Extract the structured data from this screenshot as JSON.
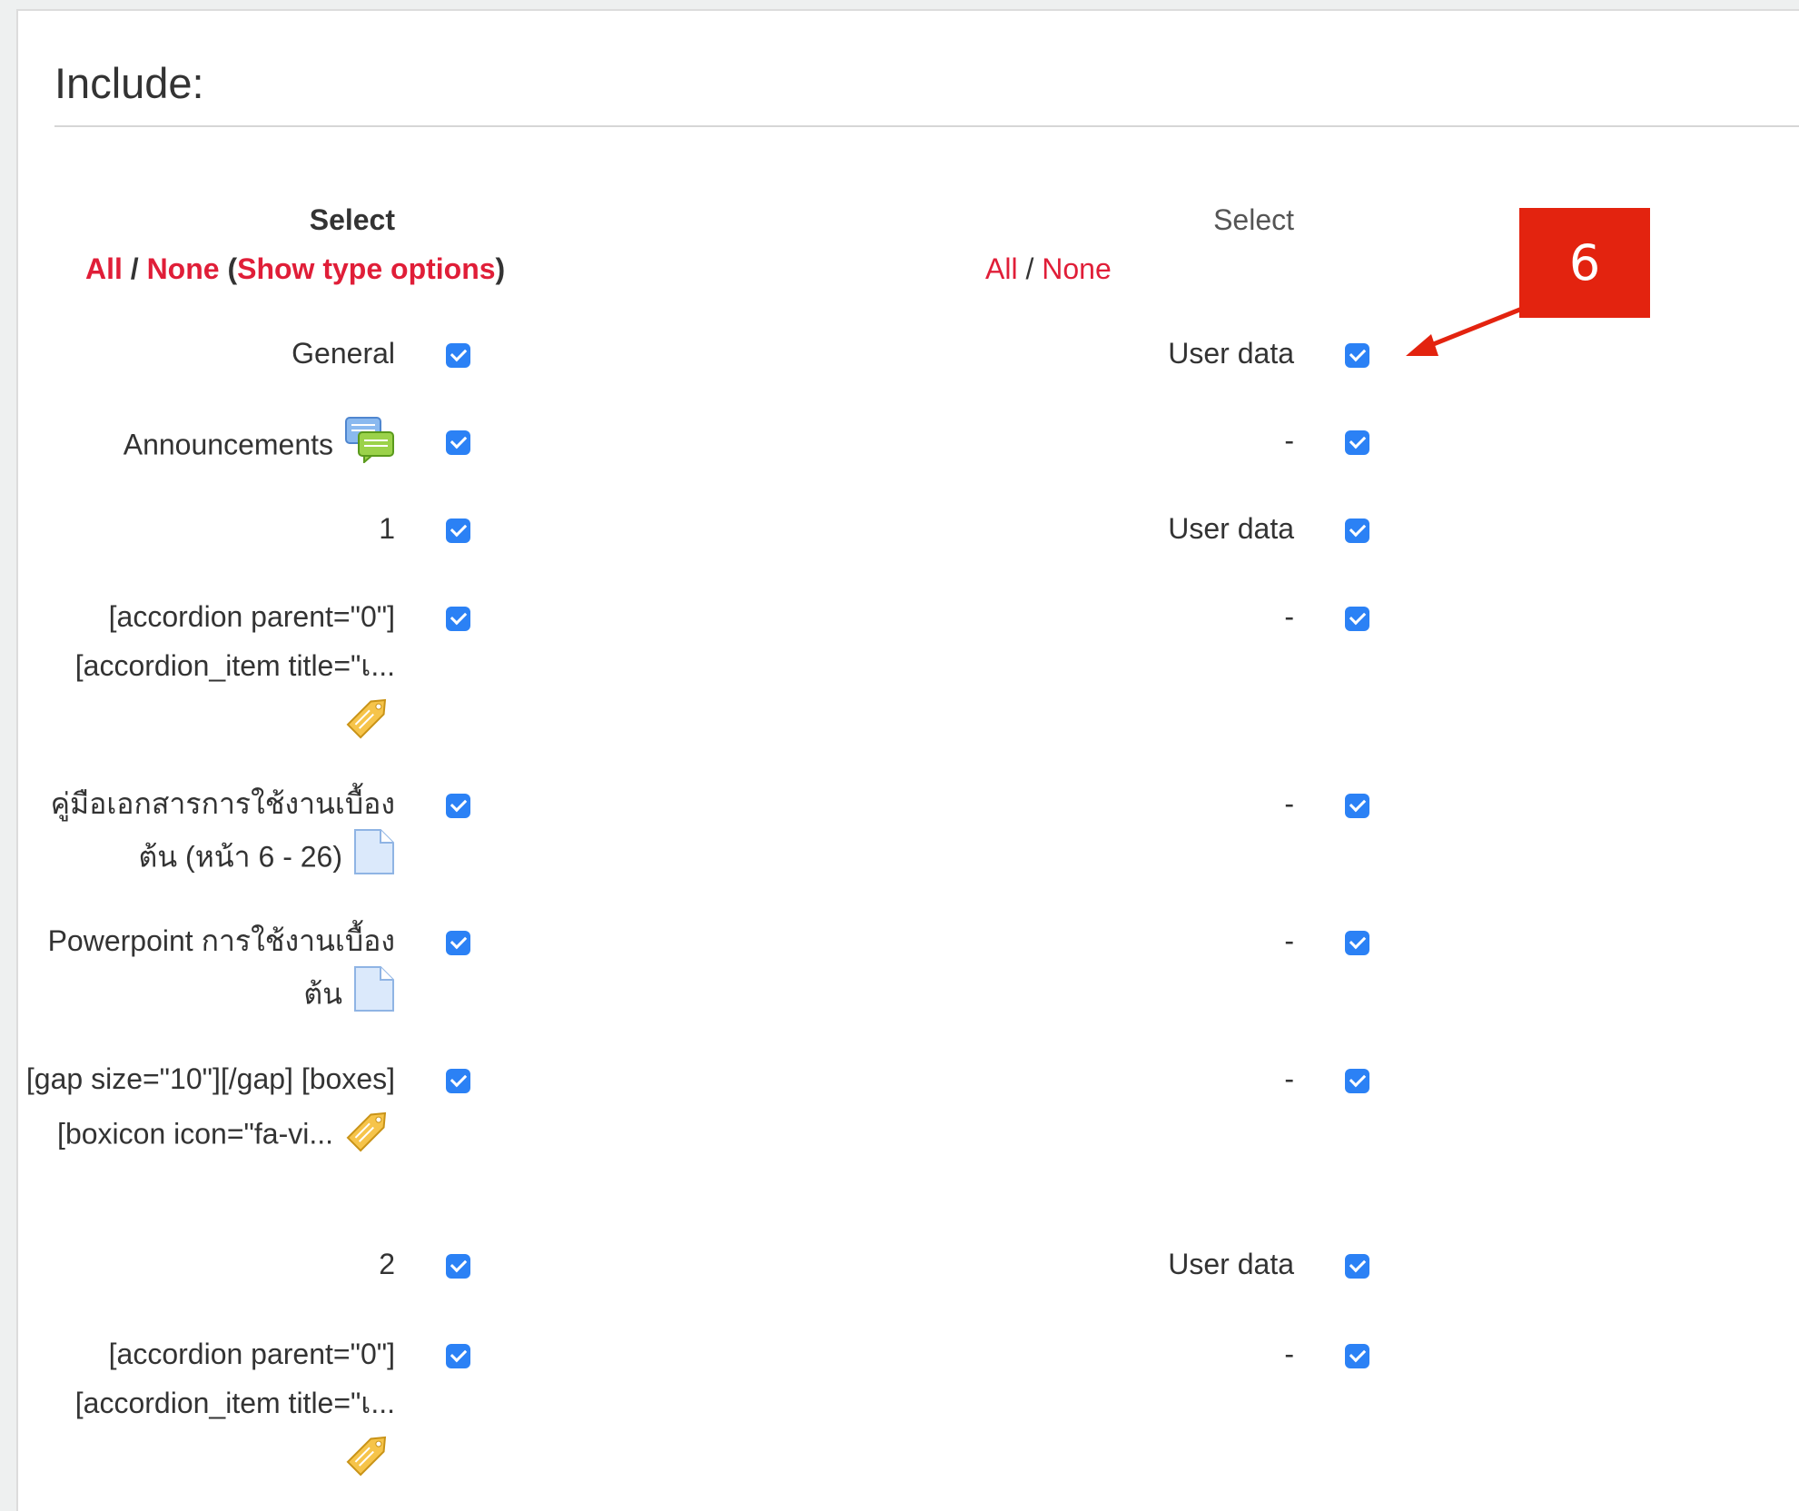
{
  "heading": "Include:",
  "left": {
    "select_label": "Select",
    "all": "All",
    "sep": " / ",
    "none": "None",
    "open_paren": " (",
    "show_type": "Show type options",
    "close_paren": ")"
  },
  "right": {
    "select_label": "Select",
    "all": "All",
    "sep": " / ",
    "none": "None"
  },
  "rows": [
    {
      "label": "General",
      "icon": "",
      "right_label": "User data"
    },
    {
      "label": "Announcements",
      "icon": "forum-chat-icon",
      "right_label": "-"
    },
    {
      "label": "1",
      "icon": "",
      "right_label": "User data"
    },
    {
      "label": "[accordion parent=\"0\"] [accordion_item title=\"เ...",
      "icon": "label-tag-icon",
      "right_label": "-"
    },
    {
      "label": "คู่มือเอกสารการใช้งานเบื้องต้น (หน้า 6 - 26)",
      "icon": "file-icon",
      "right_label": "-"
    },
    {
      "label": "Powerpoint การใช้งานเบื้องต้น",
      "icon": "file-icon",
      "right_label": "-"
    },
    {
      "label": "[gap size=\"10\"][/gap] [boxes][boxicon icon=\"fa-vi...",
      "icon": "label-tag-icon",
      "right_label": "-"
    },
    {
      "label": "2",
      "icon": "",
      "right_label": "User data"
    },
    {
      "label": "[accordion parent=\"0\"] [accordion_item title=\"เ...",
      "icon": "label-tag-icon",
      "right_label": "-"
    }
  ],
  "callout_number": "6",
  "colors": {
    "link": "#e01e38",
    "checkbox": "#2b81f5",
    "callout": "#e3230f"
  }
}
